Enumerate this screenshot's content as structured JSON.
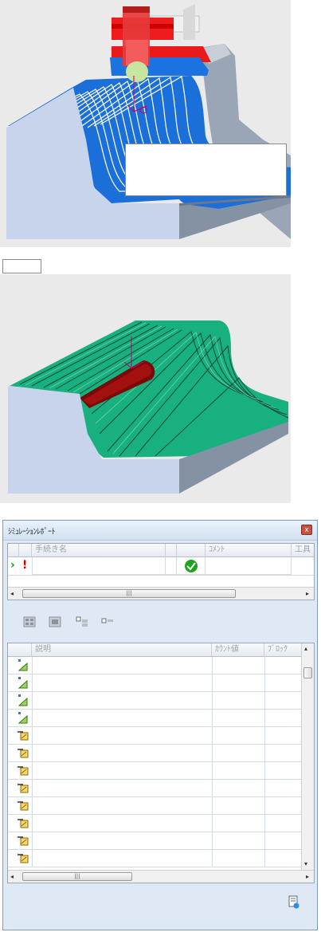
{
  "viewport1": {
    "annotation": ""
  },
  "viewport2": {
    "label": ""
  },
  "dialog": {
    "title": "ｼﾐｭﾚｰｼｮﾝﾚﾎﾟｰﾄ",
    "close_label": "x",
    "upper_table": {
      "columns": [
        "",
        "",
        "手続き名",
        "",
        "",
        "ｺﾒﾝﾄ",
        "工具"
      ],
      "row": {
        "expand_icon": "›",
        "error_icon": "!",
        "name": "",
        "comment": "",
        "status_icon": "check-ok-icon"
      }
    },
    "upper_scroll_thumb": "|||",
    "toolbar": [
      "expand-all-icon",
      "collapse-all-icon",
      "expand-selected-icon",
      "collapse-selected-icon"
    ],
    "lower_table": {
      "columns": [
        "",
        "説明",
        "ｶｳﾝﾄ値",
        "ﾌﾞﾛｯｸ"
      ],
      "rows": [
        {
          "icon": "info-note-icon"
        },
        {
          "icon": "info-note-icon"
        },
        {
          "icon": "info-note-icon"
        },
        {
          "icon": "info-note-icon"
        },
        {
          "icon": "tool-warning-icon"
        },
        {
          "icon": "tool-warning-icon"
        },
        {
          "icon": "tool-warning-icon"
        },
        {
          "icon": "tool-warning-icon"
        },
        {
          "icon": "tool-warning-icon"
        },
        {
          "icon": "tool-warning-icon"
        },
        {
          "icon": "tool-warning-icon"
        },
        {
          "icon": "tool-warning-icon"
        }
      ]
    },
    "lower_scroll_thumb": "|||",
    "footer_icon": "report-export-icon"
  }
}
